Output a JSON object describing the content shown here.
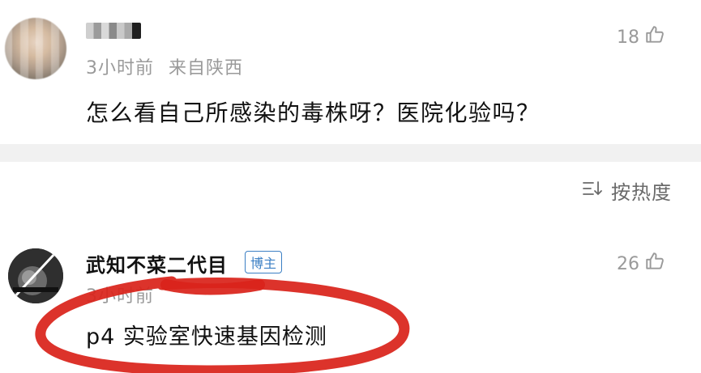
{
  "comments": [
    {
      "name": "",
      "time": "3小时前",
      "location": "来自陕西",
      "text": "怎么看自己所感染的毒株呀？医院化验吗？",
      "likes": "18"
    },
    {
      "name": "武知不菜二代目",
      "badge": "博主",
      "time": "3小时前",
      "location": "",
      "text": "p4 实验室快速基因检测",
      "likes": "26"
    }
  ],
  "sort": {
    "label": "按热度"
  },
  "colors": {
    "text": "#111111",
    "muted": "#9a9a9a",
    "badge": "#3b7fc4",
    "marker": "#d9231b",
    "divider": "#f1f1f1"
  },
  "icons": {
    "like": "thumbs-up-icon",
    "sort": "sort-icon"
  }
}
